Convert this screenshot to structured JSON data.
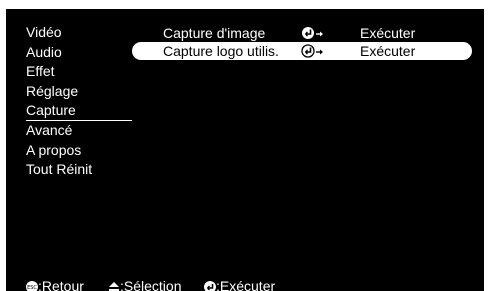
{
  "left_menu": {
    "items": [
      {
        "label": "Vidéo"
      },
      {
        "label": "Audio"
      },
      {
        "label": "Effet"
      },
      {
        "label": "Réglage"
      },
      {
        "label": "Capture",
        "active": true
      },
      {
        "label": "Avancé"
      },
      {
        "label": "A propos"
      },
      {
        "label": "Tout Réinit"
      }
    ]
  },
  "options": [
    {
      "label": "Capture d'image",
      "icon": "enter-arrow-icon",
      "value": "Exécuter",
      "selected": false
    },
    {
      "label": "Capture logo utilis.",
      "icon": "enter-arrow-icon",
      "value": "Exécuter",
      "selected": true
    }
  ],
  "status_bar": {
    "back_icon": "esc-icon",
    "back_label": ":Retour",
    "select_icon": "up-down-icon",
    "select_label": ":Sélection",
    "execute_icon": "enter-icon",
    "execute_label": ":Exécuter"
  },
  "colors": {
    "screen_background": "#000000",
    "text": "#ffffff",
    "highlight": "#ffffff",
    "highlight_text": "#000000"
  }
}
